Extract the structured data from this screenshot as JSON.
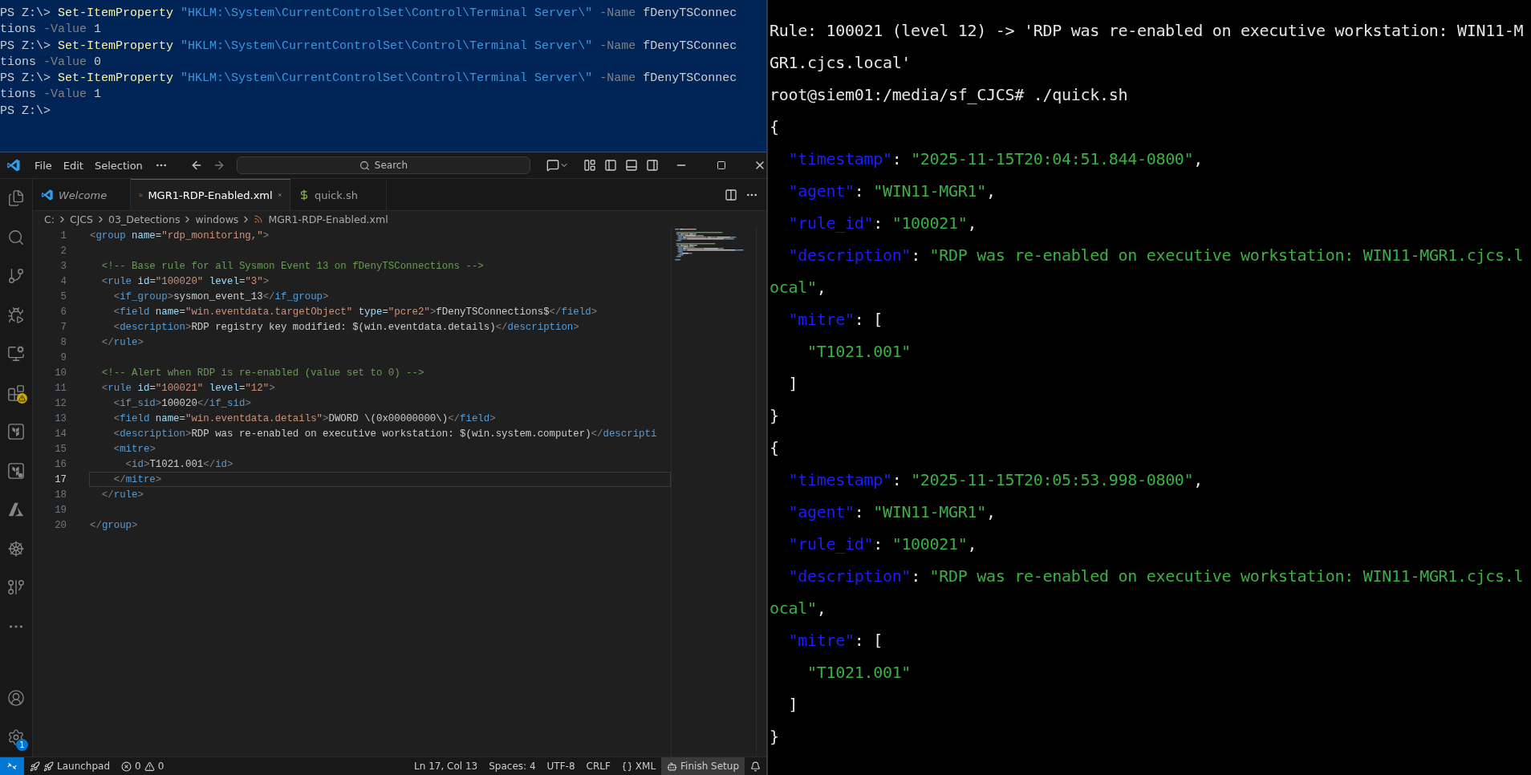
{
  "powershell": {
    "lines": [
      {
        "segments": [
          {
            "kind": "plain",
            "text": "PS Z:\\> "
          },
          {
            "kind": "cmdlet",
            "text": "Set-ItemProperty"
          },
          {
            "kind": "string",
            "text": " \"HKLM:\\System\\CurrentControlSet\\Control\\Terminal Server\\\""
          },
          {
            "kind": "param",
            "text": " -Name"
          },
          {
            "kind": "plain",
            "text": " fDenyTSConnec"
          }
        ]
      },
      {
        "segments": [
          {
            "kind": "plain",
            "text": "tions"
          },
          {
            "kind": "param",
            "text": " -Value"
          },
          {
            "kind": "plain",
            "text": " 1"
          }
        ]
      },
      {
        "segments": [
          {
            "kind": "plain",
            "text": "PS Z:\\> "
          },
          {
            "kind": "cmdlet",
            "text": "Set-ItemProperty"
          },
          {
            "kind": "string",
            "text": " \"HKLM:\\System\\CurrentControlSet\\Control\\Terminal Server\\\""
          },
          {
            "kind": "param",
            "text": " -Name"
          },
          {
            "kind": "plain",
            "text": " fDenyTSConnec"
          }
        ]
      },
      {
        "segments": [
          {
            "kind": "plain",
            "text": "tions"
          },
          {
            "kind": "param",
            "text": " -Value"
          },
          {
            "kind": "plain",
            "text": " 0"
          }
        ]
      },
      {
        "segments": [
          {
            "kind": "plain",
            "text": "PS Z:\\> "
          },
          {
            "kind": "cmdlet",
            "text": "Set-ItemProperty"
          },
          {
            "kind": "string",
            "text": " \"HKLM:\\System\\CurrentControlSet\\Control\\Terminal Server\\\""
          },
          {
            "kind": "param",
            "text": " -Name"
          },
          {
            "kind": "plain",
            "text": " fDenyTSConnec"
          }
        ]
      },
      {
        "segments": [
          {
            "kind": "plain",
            "text": "tions"
          },
          {
            "kind": "param",
            "text": " -Value"
          },
          {
            "kind": "plain",
            "text": " 1"
          }
        ]
      },
      {
        "segments": [
          {
            "kind": "plain",
            "text": "PS Z:\\>"
          }
        ]
      }
    ]
  },
  "vscode": {
    "menu": [
      "File",
      "Edit",
      "Selection"
    ],
    "command_center": {
      "label": "Search"
    },
    "activity_bar": {
      "top": [
        {
          "kind": "explorer"
        },
        {
          "kind": "search"
        },
        {
          "kind": "scm"
        },
        {
          "kind": "debug"
        },
        {
          "kind": "remote"
        },
        {
          "kind": "extensions"
        },
        {
          "kind": "terraform"
        },
        {
          "kind": "terraform-cloud"
        },
        {
          "kind": "azure"
        },
        {
          "kind": "kubernetes"
        },
        {
          "kind": "git"
        },
        {
          "kind": "more"
        }
      ],
      "bottom": [
        {
          "kind": "account"
        },
        {
          "kind": "settings",
          "badge": "1"
        }
      ]
    },
    "tabs": [
      {
        "label": "Welcome",
        "kind": "welcome",
        "selected": false
      },
      {
        "label": "MGR1-RDP-Enabled.xml",
        "kind": "xml",
        "selected": true
      },
      {
        "label": "quick.sh",
        "kind": "shell",
        "selected": false
      }
    ],
    "breadcrumbs": [
      {
        "label": "C:",
        "kind": "folder"
      },
      {
        "label": "CJCS",
        "kind": "folder"
      },
      {
        "label": "03_Detections",
        "kind": "folder"
      },
      {
        "label": "windows",
        "kind": "folder"
      },
      {
        "label": "MGR1-RDP-Enabled.xml",
        "kind": "file"
      }
    ],
    "code": [
      {
        "number": "1",
        "current": false,
        "segments": [
          {
            "kind": "punct",
            "text": "<"
          },
          {
            "kind": "tag",
            "text": "group"
          },
          {
            "kind": "attr",
            "text": " name"
          },
          {
            "kind": "text",
            "text": "="
          },
          {
            "kind": "value",
            "text": "\"rdp_monitoring,\""
          },
          {
            "kind": "punct",
            "text": ">"
          }
        ]
      },
      {
        "number": "2",
        "current": false
      },
      {
        "number": "3",
        "current": false,
        "segments": [
          {
            "kind": "comment",
            "text": "  <!-- Base rule for all Sysmon Event 13 on fDenyTSConnections -->"
          }
        ]
      },
      {
        "number": "4",
        "current": false,
        "segments": [
          {
            "kind": "punct",
            "text": "  <"
          },
          {
            "kind": "tag",
            "text": "rule"
          },
          {
            "kind": "attr",
            "text": " id"
          },
          {
            "kind": "text",
            "text": "="
          },
          {
            "kind": "value",
            "text": "\"100020\""
          },
          {
            "kind": "attr",
            "text": " level"
          },
          {
            "kind": "text",
            "text": "="
          },
          {
            "kind": "value",
            "text": "\"3\""
          },
          {
            "kind": "punct",
            "text": ">"
          }
        ]
      },
      {
        "number": "5",
        "current": false,
        "segments": [
          {
            "kind": "punct",
            "text": "    <"
          },
          {
            "kind": "tag",
            "text": "if_group"
          },
          {
            "kind": "punct",
            "text": ">"
          },
          {
            "kind": "text",
            "text": "sysmon_event_13"
          },
          {
            "kind": "punct",
            "text": "</"
          },
          {
            "kind": "tag",
            "text": "if_group"
          },
          {
            "kind": "punct",
            "text": ">"
          }
        ]
      },
      {
        "number": "6",
        "current": false,
        "segments": [
          {
            "kind": "punct",
            "text": "    <"
          },
          {
            "kind": "tag",
            "text": "field"
          },
          {
            "kind": "attr",
            "text": " name"
          },
          {
            "kind": "text",
            "text": "="
          },
          {
            "kind": "value",
            "text": "\"win.eventdata.targetObject\""
          },
          {
            "kind": "attr",
            "text": " type"
          },
          {
            "kind": "text",
            "text": "="
          },
          {
            "kind": "value",
            "text": "\"pcre2\""
          },
          {
            "kind": "punct",
            "text": ">"
          },
          {
            "kind": "text",
            "text": "fDenyTSConnections$"
          },
          {
            "kind": "punct",
            "text": "</"
          },
          {
            "kind": "tag",
            "text": "field"
          },
          {
            "kind": "punct",
            "text": ">"
          }
        ]
      },
      {
        "number": "7",
        "current": false,
        "segments": [
          {
            "kind": "punct",
            "text": "    <"
          },
          {
            "kind": "tag",
            "text": "description"
          },
          {
            "kind": "punct",
            "text": ">"
          },
          {
            "kind": "text",
            "text": "RDP registry key modified: $(win.eventdata.details)"
          },
          {
            "kind": "punct",
            "text": "</"
          },
          {
            "kind": "tag",
            "text": "description"
          },
          {
            "kind": "punct",
            "text": ">"
          }
        ]
      },
      {
        "number": "8",
        "current": false,
        "segments": [
          {
            "kind": "punct",
            "text": "  </"
          },
          {
            "kind": "tag",
            "text": "rule"
          },
          {
            "kind": "punct",
            "text": ">"
          }
        ]
      },
      {
        "number": "9",
        "current": false
      },
      {
        "number": "10",
        "current": false,
        "segments": [
          {
            "kind": "comment",
            "text": "  <!-- Alert when RDP is re-enabled (value set to 0) -->"
          }
        ]
      },
      {
        "number": "11",
        "current": false,
        "segments": [
          {
            "kind": "punct",
            "text": "  <"
          },
          {
            "kind": "tag",
            "text": "rule"
          },
          {
            "kind": "attr",
            "text": " id"
          },
          {
            "kind": "text",
            "text": "="
          },
          {
            "kind": "value",
            "text": "\"100021\""
          },
          {
            "kind": "attr",
            "text": " level"
          },
          {
            "kind": "text",
            "text": "="
          },
          {
            "kind": "value",
            "text": "\"12\""
          },
          {
            "kind": "punct",
            "text": ">"
          }
        ]
      },
      {
        "number": "12",
        "current": false,
        "segments": [
          {
            "kind": "punct",
            "text": "    <"
          },
          {
            "kind": "tag",
            "text": "if_sid"
          },
          {
            "kind": "punct",
            "text": ">"
          },
          {
            "kind": "text",
            "text": "100020"
          },
          {
            "kind": "punct",
            "text": "</"
          },
          {
            "kind": "tag",
            "text": "if_sid"
          },
          {
            "kind": "punct",
            "text": ">"
          }
        ]
      },
      {
        "number": "13",
        "current": false,
        "segments": [
          {
            "kind": "punct",
            "text": "    <"
          },
          {
            "kind": "tag",
            "text": "field"
          },
          {
            "kind": "attr",
            "text": " name"
          },
          {
            "kind": "text",
            "text": "="
          },
          {
            "kind": "value",
            "text": "\"win.eventdata.details\""
          },
          {
            "kind": "punct",
            "text": ">"
          },
          {
            "kind": "text",
            "text": "DWORD \\(0x00000000\\)"
          },
          {
            "kind": "punct",
            "text": "</"
          },
          {
            "kind": "tag",
            "text": "field"
          },
          {
            "kind": "punct",
            "text": ">"
          }
        ]
      },
      {
        "number": "14",
        "current": false,
        "segments": [
          {
            "kind": "punct",
            "text": "    <"
          },
          {
            "kind": "tag",
            "text": "description"
          },
          {
            "kind": "punct",
            "text": ">"
          },
          {
            "kind": "text",
            "text": "RDP was re-enabled on executive workstation: $(win.system.computer)"
          },
          {
            "kind": "punct",
            "text": "</"
          },
          {
            "kind": "tag",
            "text": "descripti"
          }
        ]
      },
      {
        "number": "15",
        "current": false,
        "segments": [
          {
            "kind": "punct",
            "text": "    <"
          },
          {
            "kind": "tag",
            "text": "mitre"
          },
          {
            "kind": "punct",
            "text": ">"
          }
        ]
      },
      {
        "number": "16",
        "current": false,
        "segments": [
          {
            "kind": "punct",
            "text": "      <"
          },
          {
            "kind": "tag",
            "text": "id"
          },
          {
            "kind": "punct",
            "text": ">"
          },
          {
            "kind": "text",
            "text": "T1021.001"
          },
          {
            "kind": "punct",
            "text": "</"
          },
          {
            "kind": "tag",
            "text": "id"
          },
          {
            "kind": "punct",
            "text": ">"
          }
        ]
      },
      {
        "number": "17",
        "current": true,
        "segments": [
          {
            "kind": "punct",
            "text": "    </"
          },
          {
            "kind": "tag",
            "text": "mitre"
          },
          {
            "kind": "punct",
            "text": ">"
          }
        ]
      },
      {
        "number": "18",
        "current": false,
        "segments": [
          {
            "kind": "punct",
            "text": "  </"
          },
          {
            "kind": "tag",
            "text": "rule"
          },
          {
            "kind": "punct",
            "text": ">"
          }
        ]
      },
      {
        "number": "19",
        "current": false
      },
      {
        "number": "20",
        "current": false,
        "segments": [
          {
            "kind": "punct",
            "text": "</"
          },
          {
            "kind": "tag",
            "text": "group"
          },
          {
            "kind": "punct",
            "text": ">"
          }
        ]
      }
    ],
    "status_bar": {
      "left": [
        {
          "kind": "remote"
        },
        {
          "kind": "launchpad",
          "text": "Launchpad"
        },
        {
          "kind": "problems",
          "errors": "0",
          "warnings": "0"
        }
      ],
      "right": [
        {
          "kind": "text",
          "text": "Ln 17, Col 13"
        },
        {
          "kind": "text",
          "text": "Spaces: 4"
        },
        {
          "kind": "text",
          "text": "UTF-8"
        },
        {
          "kind": "text",
          "text": "CRLF"
        },
        {
          "kind": "language",
          "text": "XML"
        },
        {
          "kind": "setup",
          "text": "Finish Setup"
        },
        {
          "kind": "bell"
        }
      ]
    }
  },
  "terminal": {
    "lines": [
      {
        "segments": [
          {
            "kind": "plain",
            "text": "Rule: 100021 (level 12) -> 'RDP was re-enabled on executive workstation: WIN11-M"
          }
        ]
      },
      {
        "segments": [
          {
            "kind": "plain",
            "text": "GR1.cjcs.local'"
          }
        ]
      },
      {
        "segments": [
          {
            "kind": "plain",
            "text": "root@siem01:/media/sf_CJCS# ./quick.sh"
          }
        ]
      },
      {
        "segments": [
          {
            "kind": "plain",
            "text": "{"
          }
        ]
      },
      {
        "segments": [
          {
            "kind": "key",
            "text": "  \"timestamp\""
          },
          {
            "kind": "plain",
            "text": ": "
          },
          {
            "kind": "string",
            "text": "\"2025-11-15T20:04:51.844-0800\""
          },
          {
            "kind": "plain",
            "text": ","
          }
        ]
      },
      {
        "segments": [
          {
            "kind": "key",
            "text": "  \"agent\""
          },
          {
            "kind": "plain",
            "text": ": "
          },
          {
            "kind": "string",
            "text": "\"WIN11-MGR1\""
          },
          {
            "kind": "plain",
            "text": ","
          }
        ]
      },
      {
        "segments": [
          {
            "kind": "key",
            "text": "  \"rule_id\""
          },
          {
            "kind": "plain",
            "text": ": "
          },
          {
            "kind": "string",
            "text": "\"100021\""
          },
          {
            "kind": "plain",
            "text": ","
          }
        ]
      },
      {
        "segments": [
          {
            "kind": "key",
            "text": "  \"description\""
          },
          {
            "kind": "plain",
            "text": ": "
          },
          {
            "kind": "string",
            "text": "\"RDP was re-enabled on executive workstation: WIN11-MGR1.cjcs.l"
          }
        ]
      },
      {
        "segments": [
          {
            "kind": "string",
            "text": "ocal\""
          },
          {
            "kind": "plain",
            "text": ","
          }
        ]
      },
      {
        "segments": [
          {
            "kind": "key",
            "text": "  \"mitre\""
          },
          {
            "kind": "plain",
            "text": ": ["
          }
        ]
      },
      {
        "segments": [
          {
            "kind": "string",
            "text": "    \"T1021.001\""
          }
        ]
      },
      {
        "segments": [
          {
            "kind": "plain",
            "text": "  ]"
          }
        ]
      },
      {
        "segments": [
          {
            "kind": "plain",
            "text": "}"
          }
        ]
      },
      {
        "segments": [
          {
            "kind": "plain",
            "text": "{"
          }
        ]
      },
      {
        "segments": [
          {
            "kind": "key",
            "text": "  \"timestamp\""
          },
          {
            "kind": "plain",
            "text": ": "
          },
          {
            "kind": "string",
            "text": "\"2025-11-15T20:05:53.998-0800\""
          },
          {
            "kind": "plain",
            "text": ","
          }
        ]
      },
      {
        "segments": [
          {
            "kind": "key",
            "text": "  \"agent\""
          },
          {
            "kind": "plain",
            "text": ": "
          },
          {
            "kind": "string",
            "text": "\"WIN11-MGR1\""
          },
          {
            "kind": "plain",
            "text": ","
          }
        ]
      },
      {
        "segments": [
          {
            "kind": "key",
            "text": "  \"rule_id\""
          },
          {
            "kind": "plain",
            "text": ": "
          },
          {
            "kind": "string",
            "text": "\"100021\""
          },
          {
            "kind": "plain",
            "text": ","
          }
        ]
      },
      {
        "segments": [
          {
            "kind": "key",
            "text": "  \"description\""
          },
          {
            "kind": "plain",
            "text": ": "
          },
          {
            "kind": "string",
            "text": "\"RDP was re-enabled on executive workstation: WIN11-MGR1.cjcs.l"
          }
        ]
      },
      {
        "segments": [
          {
            "kind": "string",
            "text": "ocal\""
          },
          {
            "kind": "plain",
            "text": ","
          }
        ]
      },
      {
        "segments": [
          {
            "kind": "key",
            "text": "  \"mitre\""
          },
          {
            "kind": "plain",
            "text": ": ["
          }
        ]
      },
      {
        "segments": [
          {
            "kind": "string",
            "text": "    \"T1021.001\""
          }
        ]
      },
      {
        "segments": [
          {
            "kind": "plain",
            "text": "  ]"
          }
        ]
      },
      {
        "segments": [
          {
            "kind": "plain",
            "text": "}"
          }
        ]
      }
    ]
  }
}
